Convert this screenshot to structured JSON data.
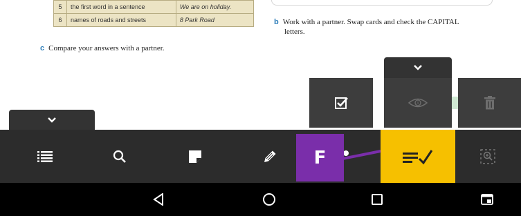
{
  "book": {
    "rows": [
      {
        "num": "5",
        "rule": "the first word in a sentence",
        "example": "We are on holiday."
      },
      {
        "num": "6",
        "rule": "names of roads and streets",
        "example": "8 Park Road"
      }
    ],
    "question_b": {
      "letter": "b",
      "line1": "Work with a partner. Swap cards and check the CAPITAL",
      "line2": "letters."
    },
    "question_c": {
      "letter": "c",
      "text": "Compare your answers with a partner."
    }
  },
  "overlay": {
    "badge_label": "F",
    "colors": {
      "toolbar": "#2c2c2c",
      "active": "#f6c000",
      "badge": "#7a2eaa",
      "annotation_line": "#7a2eaa"
    }
  },
  "tools": [
    {
      "icon": "checkbox-icon",
      "state": "enabled"
    },
    {
      "icon": "eye-icon",
      "state": "disabled"
    },
    {
      "icon": "trash-icon",
      "state": "disabled"
    }
  ],
  "toolbar": {
    "items": [
      "list-icon",
      "search-icon",
      "sticky-note-icon",
      "pencil-icon",
      "mark-answers-icon",
      "zoom-area-icon"
    ],
    "active": "mark-answers-icon"
  },
  "navbar": {
    "items": [
      "back-icon",
      "home-icon",
      "recents-icon",
      "screen-icon"
    ]
  }
}
